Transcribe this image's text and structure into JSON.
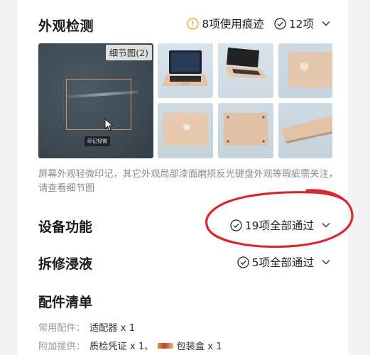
{
  "appearance": {
    "title": "外观检测",
    "wear_count": "8项使用痕迹",
    "check_count": "12项",
    "detail_tag": "细节图(2)",
    "marker_label": "印记轻微",
    "description": "屏幕外观轻微印记，其它外观局部漆面磨损反光键盘外观等瑕疵需关注，请查看细节图"
  },
  "functions": {
    "title": "设备功能",
    "status": "19项全部通过"
  },
  "repair": {
    "title": "拆修浸液",
    "status": "5项全部通过"
  },
  "accessories": {
    "title": "配件清单",
    "common_label": "常用配件：",
    "common_value": "适配器 x 1",
    "extra_label": "附加提供：",
    "extra_value_1": "质检凭证 x 1、",
    "extra_value_2": "包装盒 x 1"
  },
  "colors": {
    "warning": "#f0a520",
    "annotation": "#d8282f",
    "tag_bg": "#ebebeb"
  }
}
